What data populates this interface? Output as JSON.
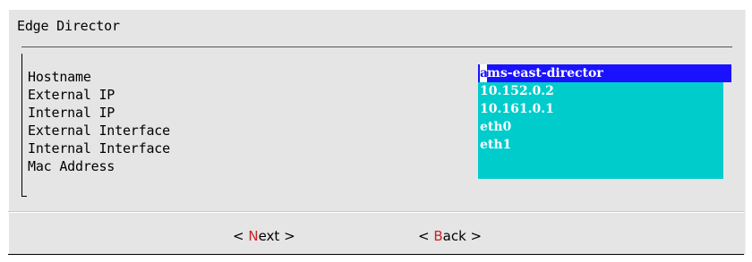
{
  "dialog": {
    "title": "Edge Director"
  },
  "form": {
    "labels": [
      "Hostname",
      "External IP",
      "Internal IP",
      "External Interface",
      "Internal Interface",
      "Mac Address"
    ],
    "values": [
      "ams-east-director",
      "10.152.0.2",
      "10.161.0.1",
      "eth0",
      "eth1",
      ""
    ],
    "hostname_cursor_char": "a",
    "hostname_rest": "ms-east-director",
    "active_field_color": "#1a12ff",
    "field_color": "#00cccc"
  },
  "buttons": {
    "next": {
      "open": "< ",
      "hot": "N",
      "rest": "ext >"
    },
    "back": {
      "open": "< ",
      "hot": "B",
      "rest": "ack >"
    },
    "hot_color": "#cc2222"
  }
}
